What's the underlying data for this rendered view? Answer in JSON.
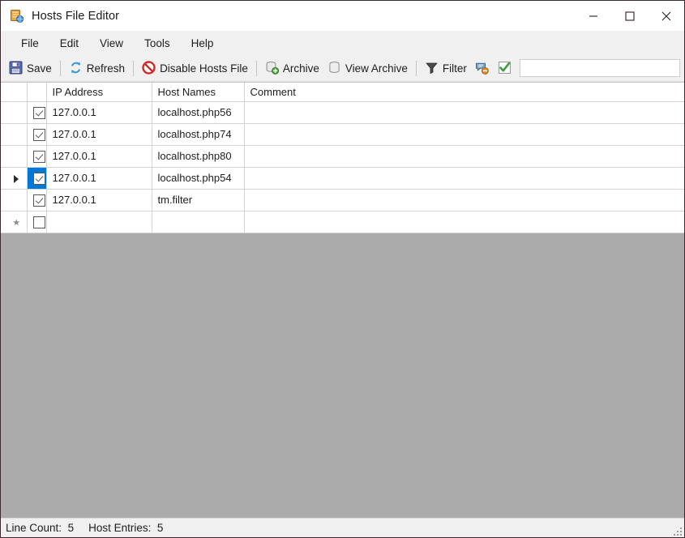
{
  "window": {
    "title": "Hosts File Editor",
    "app_icon": "hosts-file-icon",
    "controls": {
      "minimize": "minimize-icon",
      "maximize": "maximize-icon",
      "close": "close-icon"
    }
  },
  "menubar": {
    "items": [
      {
        "label": "File"
      },
      {
        "label": "Edit"
      },
      {
        "label": "View"
      },
      {
        "label": "Tools"
      },
      {
        "label": "Help"
      }
    ]
  },
  "toolbar": {
    "buttons": [
      {
        "label": "Save",
        "icon": "save-floppy-icon"
      },
      {
        "label": "Refresh",
        "icon": "refresh-arrows-icon"
      },
      {
        "label": "Disable Hosts File",
        "icon": "disable-prohibition-icon"
      },
      {
        "label": "Archive",
        "icon": "archive-add-icon"
      },
      {
        "label": "View Archive",
        "icon": "archive-view-icon"
      },
      {
        "label": "Filter",
        "icon": "filter-funnel-icon"
      }
    ],
    "toggle_comment": {
      "icon": "comment-bubble-icon"
    },
    "toggle_enabled": {
      "icon": "green-check-icon"
    },
    "filter_field": {
      "value": "",
      "placeholder": ""
    }
  },
  "grid": {
    "columns": [
      {
        "key": "rowhdr",
        "label": ""
      },
      {
        "key": "enabled",
        "label": ""
      },
      {
        "key": "ip",
        "label": "IP Address"
      },
      {
        "key": "host",
        "label": "Host Names"
      },
      {
        "key": "comment",
        "label": "Comment"
      }
    ],
    "rows": [
      {
        "marker": "",
        "enabled": true,
        "ip": "127.0.0.1",
        "host": "localhost.php56",
        "comment": "",
        "current": false
      },
      {
        "marker": "",
        "enabled": true,
        "ip": "127.0.0.1",
        "host": "localhost.php74",
        "comment": "",
        "current": false
      },
      {
        "marker": "",
        "enabled": true,
        "ip": "127.0.0.1",
        "host": "localhost.php80",
        "comment": "",
        "current": false
      },
      {
        "marker": "current",
        "enabled": true,
        "ip": "127.0.0.1",
        "host": "localhost.php54",
        "comment": "",
        "current": true
      },
      {
        "marker": "",
        "enabled": true,
        "ip": "127.0.0.1",
        "host": "tm.filter",
        "comment": "",
        "current": false
      },
      {
        "marker": "new",
        "enabled": false,
        "ip": "",
        "host": "",
        "comment": "",
        "current": false
      }
    ]
  },
  "statusbar": {
    "line_count_label": "Line Count:",
    "line_count_value": "5",
    "host_entries_label": "Host Entries:",
    "host_entries_value": "5",
    "grip": "resize-grip-icon"
  },
  "colors": {
    "selection_blue": "#0078d7",
    "panel_gray": "#ababab",
    "chrome_gray": "#f0f0f0",
    "check_green": "#3ca13c",
    "disable_red": "#cf2a27"
  }
}
